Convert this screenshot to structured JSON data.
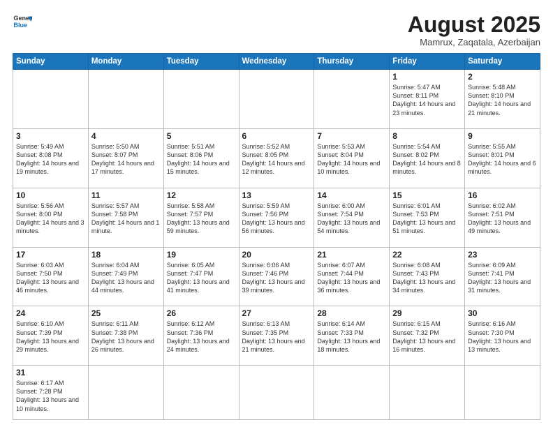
{
  "header": {
    "logo": {
      "line1": "General",
      "line2": "Blue"
    },
    "title": "August 2025",
    "subtitle": "Mamrux, Zaqatala, Azerbaijan"
  },
  "days_of_week": [
    "Sunday",
    "Monday",
    "Tuesday",
    "Wednesday",
    "Thursday",
    "Friday",
    "Saturday"
  ],
  "weeks": [
    [
      {
        "day": null,
        "info": null
      },
      {
        "day": null,
        "info": null
      },
      {
        "day": null,
        "info": null
      },
      {
        "day": null,
        "info": null
      },
      {
        "day": null,
        "info": null
      },
      {
        "day": "1",
        "info": "Sunrise: 5:47 AM\nSunset: 8:11 PM\nDaylight: 14 hours and 23 minutes."
      },
      {
        "day": "2",
        "info": "Sunrise: 5:48 AM\nSunset: 8:10 PM\nDaylight: 14 hours and 21 minutes."
      }
    ],
    [
      {
        "day": "3",
        "info": "Sunrise: 5:49 AM\nSunset: 8:08 PM\nDaylight: 14 hours and 19 minutes."
      },
      {
        "day": "4",
        "info": "Sunrise: 5:50 AM\nSunset: 8:07 PM\nDaylight: 14 hours and 17 minutes."
      },
      {
        "day": "5",
        "info": "Sunrise: 5:51 AM\nSunset: 8:06 PM\nDaylight: 14 hours and 15 minutes."
      },
      {
        "day": "6",
        "info": "Sunrise: 5:52 AM\nSunset: 8:05 PM\nDaylight: 14 hours and 12 minutes."
      },
      {
        "day": "7",
        "info": "Sunrise: 5:53 AM\nSunset: 8:04 PM\nDaylight: 14 hours and 10 minutes."
      },
      {
        "day": "8",
        "info": "Sunrise: 5:54 AM\nSunset: 8:02 PM\nDaylight: 14 hours and 8 minutes."
      },
      {
        "day": "9",
        "info": "Sunrise: 5:55 AM\nSunset: 8:01 PM\nDaylight: 14 hours and 6 minutes."
      }
    ],
    [
      {
        "day": "10",
        "info": "Sunrise: 5:56 AM\nSunset: 8:00 PM\nDaylight: 14 hours and 3 minutes."
      },
      {
        "day": "11",
        "info": "Sunrise: 5:57 AM\nSunset: 7:58 PM\nDaylight: 14 hours and 1 minute."
      },
      {
        "day": "12",
        "info": "Sunrise: 5:58 AM\nSunset: 7:57 PM\nDaylight: 13 hours and 59 minutes."
      },
      {
        "day": "13",
        "info": "Sunrise: 5:59 AM\nSunset: 7:56 PM\nDaylight: 13 hours and 56 minutes."
      },
      {
        "day": "14",
        "info": "Sunrise: 6:00 AM\nSunset: 7:54 PM\nDaylight: 13 hours and 54 minutes."
      },
      {
        "day": "15",
        "info": "Sunrise: 6:01 AM\nSunset: 7:53 PM\nDaylight: 13 hours and 51 minutes."
      },
      {
        "day": "16",
        "info": "Sunrise: 6:02 AM\nSunset: 7:51 PM\nDaylight: 13 hours and 49 minutes."
      }
    ],
    [
      {
        "day": "17",
        "info": "Sunrise: 6:03 AM\nSunset: 7:50 PM\nDaylight: 13 hours and 46 minutes."
      },
      {
        "day": "18",
        "info": "Sunrise: 6:04 AM\nSunset: 7:49 PM\nDaylight: 13 hours and 44 minutes."
      },
      {
        "day": "19",
        "info": "Sunrise: 6:05 AM\nSunset: 7:47 PM\nDaylight: 13 hours and 41 minutes."
      },
      {
        "day": "20",
        "info": "Sunrise: 6:06 AM\nSunset: 7:46 PM\nDaylight: 13 hours and 39 minutes."
      },
      {
        "day": "21",
        "info": "Sunrise: 6:07 AM\nSunset: 7:44 PM\nDaylight: 13 hours and 36 minutes."
      },
      {
        "day": "22",
        "info": "Sunrise: 6:08 AM\nSunset: 7:43 PM\nDaylight: 13 hours and 34 minutes."
      },
      {
        "day": "23",
        "info": "Sunrise: 6:09 AM\nSunset: 7:41 PM\nDaylight: 13 hours and 31 minutes."
      }
    ],
    [
      {
        "day": "24",
        "info": "Sunrise: 6:10 AM\nSunset: 7:39 PM\nDaylight: 13 hours and 29 minutes."
      },
      {
        "day": "25",
        "info": "Sunrise: 6:11 AM\nSunset: 7:38 PM\nDaylight: 13 hours and 26 minutes."
      },
      {
        "day": "26",
        "info": "Sunrise: 6:12 AM\nSunset: 7:36 PM\nDaylight: 13 hours and 24 minutes."
      },
      {
        "day": "27",
        "info": "Sunrise: 6:13 AM\nSunset: 7:35 PM\nDaylight: 13 hours and 21 minutes."
      },
      {
        "day": "28",
        "info": "Sunrise: 6:14 AM\nSunset: 7:33 PM\nDaylight: 13 hours and 18 minutes."
      },
      {
        "day": "29",
        "info": "Sunrise: 6:15 AM\nSunset: 7:32 PM\nDaylight: 13 hours and 16 minutes."
      },
      {
        "day": "30",
        "info": "Sunrise: 6:16 AM\nSunset: 7:30 PM\nDaylight: 13 hours and 13 minutes."
      }
    ],
    [
      {
        "day": "31",
        "info": "Sunrise: 6:17 AM\nSunset: 7:28 PM\nDaylight: 13 hours and 10 minutes."
      },
      {
        "day": null,
        "info": null
      },
      {
        "day": null,
        "info": null
      },
      {
        "day": null,
        "info": null
      },
      {
        "day": null,
        "info": null
      },
      {
        "day": null,
        "info": null
      },
      {
        "day": null,
        "info": null
      }
    ]
  ]
}
